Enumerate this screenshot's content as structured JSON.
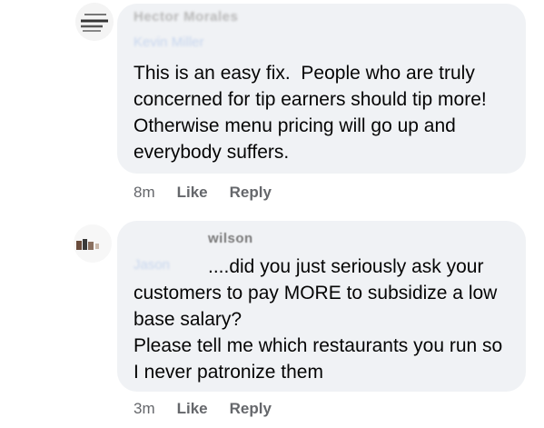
{
  "comments": [
    {
      "author": "Hector Morales",
      "mention": "Kevin Miller",
      "text": "This is an easy fix.  People who are truly concerned for tip earners should tip more!  Otherwise menu pricing will go up and everybody suffers.",
      "time": "8m",
      "like_label": "Like",
      "reply_label": "Reply"
    },
    {
      "author": "wilson",
      "mention": "Jason",
      "text": "....did you just seriously ask your customers to pay MORE to subsidize a low base salary?\nPlease tell me which restaurants you run so I never patronize them",
      "time": "3m",
      "like_label": "Like",
      "reply_label": "Reply"
    }
  ]
}
